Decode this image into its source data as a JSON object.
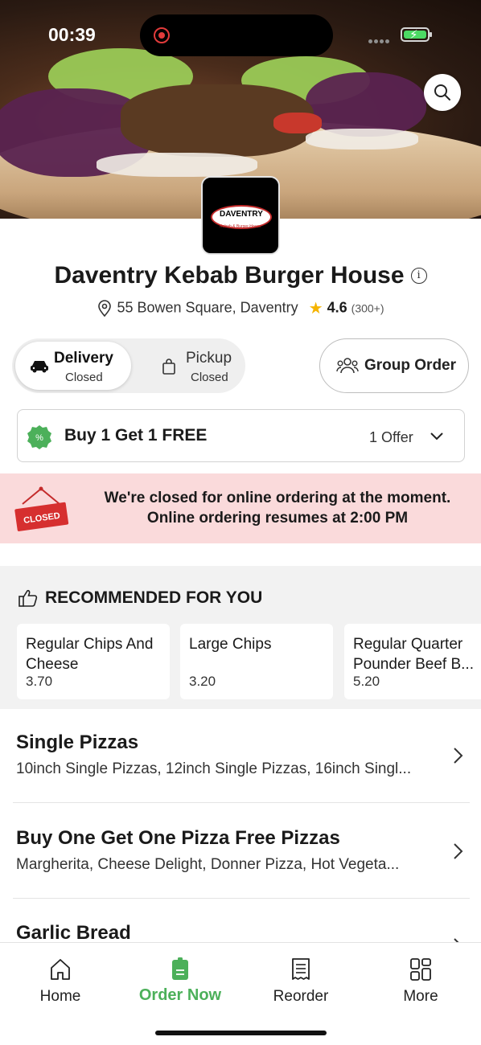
{
  "status_bar": {
    "time": "00:39"
  },
  "restaurant": {
    "logo_text": "DAVENTRY",
    "logo_subtext": "Kebab & Burger House",
    "name": "Daventry Kebab Burger House",
    "address": "55 Bowen Square, Daventry",
    "rating": "4.6",
    "rating_count": "(300+)"
  },
  "order_mode": {
    "delivery": {
      "label": "Delivery",
      "status": "Closed"
    },
    "pickup": {
      "label": "Pickup",
      "status": "Closed"
    },
    "group_order_label": "Group Order"
  },
  "offer": {
    "title": "Buy 1 Get 1 FREE",
    "count": "1 Offer"
  },
  "closed_notice": {
    "sign_text": "CLOSED",
    "line1": "We're closed for online ordering at the moment.",
    "line2": "Online ordering resumes at 2:00 PM"
  },
  "recommended": {
    "heading": "RECOMMENDED FOR YOU",
    "items": [
      {
        "name": "Regular Chips And Cheese",
        "price": "3.70"
      },
      {
        "name": "Large Chips",
        "price": "3.20"
      },
      {
        "name": "Regular Quarter Pounder Beef B...",
        "price": "5.20"
      }
    ]
  },
  "categories": [
    {
      "title": "Single Pizzas",
      "subtitle": "10inch Single Pizzas, 12inch Single Pizzas, 16inch Singl..."
    },
    {
      "title": "Buy One Get One Pizza Free Pizzas",
      "subtitle": "Margherita, Cheese Delight, Donner Pizza, Hot Vegeta..."
    },
    {
      "title": "Garlic Bread",
      "subtitle": ""
    }
  ],
  "bottom_nav": [
    {
      "label": "Home",
      "icon": "home-icon"
    },
    {
      "label": "Order Now",
      "icon": "order-icon",
      "active": true
    },
    {
      "label": "Reorder",
      "icon": "receipt-icon"
    },
    {
      "label": "More",
      "icon": "grid-icon"
    }
  ],
  "colors": {
    "accent": "#4cb05a",
    "closed_bg": "#fadadb",
    "star": "#f5b400",
    "closed_sign": "#d62f2f"
  }
}
